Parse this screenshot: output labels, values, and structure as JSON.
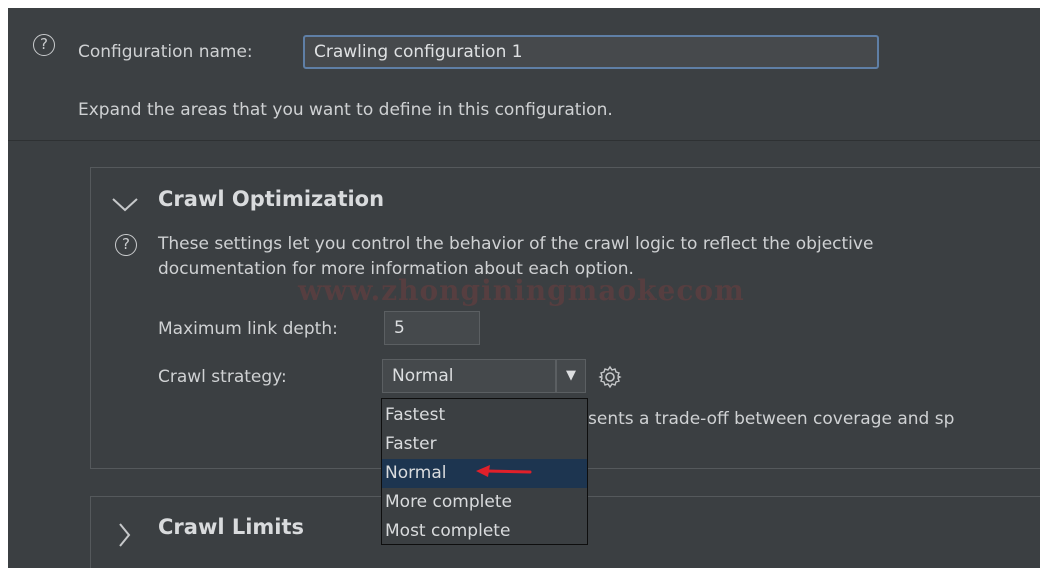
{
  "header": {
    "config_name_label": "Configuration name:",
    "config_name_value": "Crawling configuration 1",
    "instructions": "Expand the areas that you want to define in this configuration."
  },
  "crawl_optimization": {
    "title": "Crawl Optimization",
    "expanded": true,
    "description_line1": "These settings let you control the behavior of the crawl logic to reflect the objective",
    "description_line2": "documentation for more information about each option.",
    "max_link_depth_label": "Maximum link depth:",
    "max_link_depth_value": "5",
    "crawl_strategy_label": "Crawl strategy:",
    "crawl_strategy_value": "Normal",
    "strategy_hint_visible": "sents a trade-off between coverage and sp",
    "dropdown_options": [
      "Fastest",
      "Faster",
      "Normal",
      "More complete",
      "Most complete"
    ],
    "dropdown_selected_index": 2
  },
  "crawl_limits": {
    "title": "Crawl Limits",
    "expanded": false
  },
  "watermark": "www.zhonginingmaokecom",
  "colors": {
    "background": "#3b3f42",
    "selection": "#1d3550",
    "input_focus_border": "#5f7fa6",
    "annotation_arrow": "#e0202a"
  },
  "icons": [
    "help-icon",
    "chevron-down-icon",
    "chevron-right-icon",
    "dropdown-arrow-icon",
    "gear-icon",
    "annotation-arrow"
  ]
}
